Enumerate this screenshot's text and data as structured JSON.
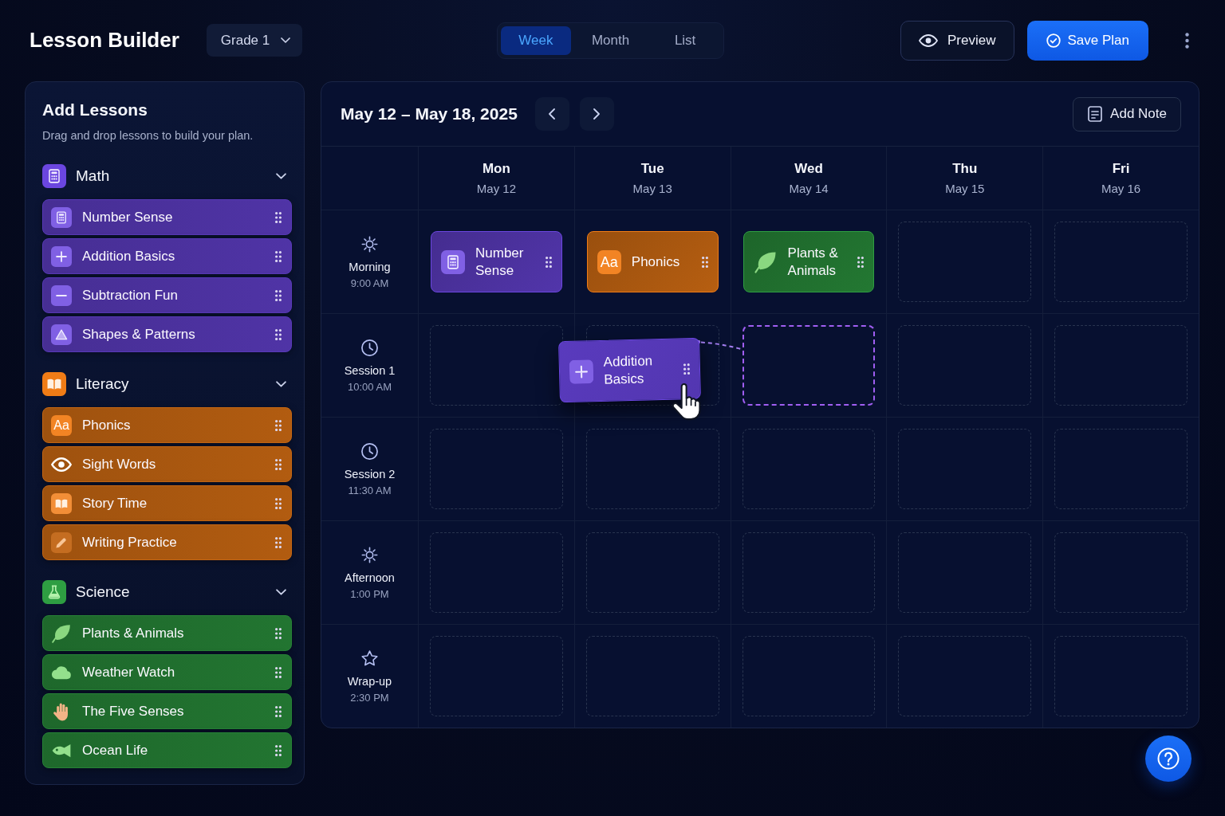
{
  "header": {
    "title": "Lesson Builder",
    "grade": "Grade 1",
    "view_tabs": [
      {
        "label": "Week",
        "selected": true
      },
      {
        "label": "Month",
        "selected": false
      },
      {
        "label": "List",
        "selected": false
      }
    ],
    "preview": "Preview",
    "save": "Save Plan"
  },
  "sidebar": {
    "title": "Add Lessons",
    "subtitle": "Drag and drop lessons to build your plan.",
    "groups": [
      {
        "name": "Math",
        "kind": "calculator",
        "color": "#6b46e0",
        "expanded": true,
        "lessons": [
          {
            "label": "Number Sense",
            "kind": "calculator"
          },
          {
            "label": "Addition Basics",
            "kind": "plus"
          },
          {
            "label": "Subtraction Fun",
            "kind": "minus"
          },
          {
            "label": "Shapes & Patterns",
            "kind": "triangle"
          }
        ]
      },
      {
        "name": "Literacy",
        "kind": "book",
        "color": "#f07c16",
        "expanded": true,
        "lessons": [
          {
            "label": "Phonics",
            "kind": "letters",
            "badge": "Aa"
          },
          {
            "label": "Sight Words",
            "kind": "eye"
          },
          {
            "label": "Story Time",
            "kind": "book"
          },
          {
            "label": "Writing Practice",
            "kind": "pencil"
          }
        ]
      },
      {
        "name": "Science",
        "kind": "flask",
        "color": "#2e9e42",
        "expanded": true,
        "lessons": [
          {
            "label": "Plants & Animals",
            "kind": "leaf"
          },
          {
            "label": "Weather Watch",
            "kind": "cloud"
          },
          {
            "label": "The Five Senses",
            "kind": "hand"
          },
          {
            "label": "Ocean Life",
            "kind": "fish"
          }
        ]
      }
    ]
  },
  "calendar": {
    "range": "May 12 – May 18, 2025",
    "add_note": "Add Note",
    "days": [
      {
        "name": "Mon",
        "date": "May 12"
      },
      {
        "name": "Tue",
        "date": "May 13"
      },
      {
        "name": "Wed",
        "date": "May 14"
      },
      {
        "name": "Thu",
        "date": "May 15"
      },
      {
        "name": "Fri",
        "date": "May 16"
      }
    ],
    "slots": [
      {
        "name": "Morning",
        "time": "9:00 AM",
        "kind": "sun",
        "cells": [
          {
            "drop_target": false,
            "lesson": {
              "label": "Number Sense",
              "kind": "calculator",
              "color": "#6b46e0"
            }
          },
          {
            "drop_target": false,
            "lesson": {
              "label": "Phonics",
              "kind": "letters",
              "badge": "Aa",
              "color": "#f07c16"
            }
          },
          {
            "drop_target": false,
            "lesson": {
              "label": "Plants & Animals",
              "kind": "leaf",
              "color": "#2e9e42"
            }
          },
          {
            "drop_target": false
          },
          {
            "drop_target": false
          }
        ]
      },
      {
        "name": "Session 1",
        "time": "10:00 AM",
        "kind": "clock",
        "cells": [
          {
            "drop_target": false
          },
          {
            "drop_target": false
          },
          {
            "drop_target": true
          },
          {
            "drop_target": false
          },
          {
            "drop_target": false
          }
        ]
      },
      {
        "name": "Session 2",
        "time": "11:30 AM",
        "kind": "clock",
        "cells": [
          {
            "drop_target": false
          },
          {
            "drop_target": false
          },
          {
            "drop_target": false
          },
          {
            "drop_target": false
          },
          {
            "drop_target": false
          }
        ]
      },
      {
        "name": "Afternoon",
        "time": "1:00 PM",
        "kind": "sun",
        "cells": [
          {
            "drop_target": false
          },
          {
            "drop_target": false
          },
          {
            "drop_target": false
          },
          {
            "drop_target": false
          },
          {
            "drop_target": false
          }
        ]
      },
      {
        "name": "Wrap-up",
        "time": "2:30 PM",
        "kind": "star",
        "cells": [
          {
            "drop_target": false
          },
          {
            "drop_target": false
          },
          {
            "drop_target": false
          },
          {
            "drop_target": false
          },
          {
            "drop_target": false
          }
        ]
      }
    ]
  },
  "drag": {
    "label": "Addition Basics",
    "kind": "plus",
    "color": "#6b46e0"
  }
}
